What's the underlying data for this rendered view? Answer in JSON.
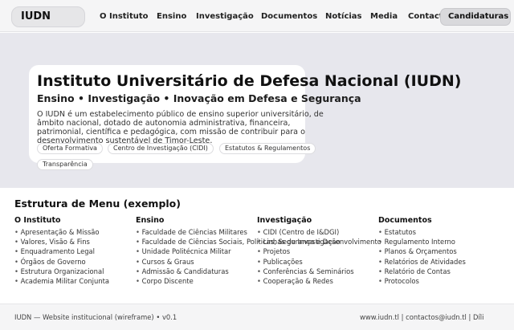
{
  "header": {
    "logo": "IUDN",
    "nav": [
      "O Instituto",
      "Ensino",
      "Investigação",
      "Documentos",
      "Notícias",
      "Media",
      "Contact"
    ],
    "cta": "Candidaturas"
  },
  "hero": {
    "title": "Instituto Universitário de Defesa Nacional (IUDN)",
    "subtitle": "Ensino • Investigação • Inovação em Defesa e Segurança",
    "description": "O IUDN é um estabelecimento público de ensino superior universitário, de âmbito nacional, dotado de autonomia administrativa, financeira, patrimonial, científica e pedagógica, com missão de contribuir para o desenvolvimento sustentável de Timor-Leste.",
    "tags": [
      "Oferta Formativa",
      "Centro de Investigação (CIDI)",
      "Estatutos & Regulamentos",
      "Transparência"
    ]
  },
  "menu": {
    "title": "Estrutura de Menu (exemplo)",
    "columns": [
      {
        "title": "O Instituto",
        "items": [
          "Apresentação & Missão",
          "Valores, Visão & Fins",
          "Enquadramento Legal",
          "Órgãos de Governo",
          "Estrutura Organizacional",
          "Academia Militar Conjunta"
        ]
      },
      {
        "title": "Ensino",
        "items": [
          "Faculdade de Ciências Militares",
          "Faculdade de Ciências Sociais, Políticas, Segurança e Desenvolvimento",
          "Unidade Politécnica Militar",
          "Cursos & Graus",
          "Admissão & Candidaturas",
          "Corpo Discente"
        ]
      },
      {
        "title": "Investigação",
        "items": [
          "CIDI (Centro de I&DGI)",
          "Linhas de Investigação",
          "Projetos",
          "Publicações",
          "Conferências & Seminários",
          "Cooperação & Redes"
        ]
      },
      {
        "title": "Documentos",
        "items": [
          "Estatutos",
          "Regulamento Interno",
          "Planos & Orçamentos",
          "Relatórios de Atividades",
          "Relatório de Contas",
          "Protocolos"
        ]
      }
    ]
  },
  "footer": {
    "left": "IUDN — Website institucional (wireframe) • v0.1",
    "right": "www.iudn.tl  |  contactos@iudn.tl  |  Díli"
  }
}
